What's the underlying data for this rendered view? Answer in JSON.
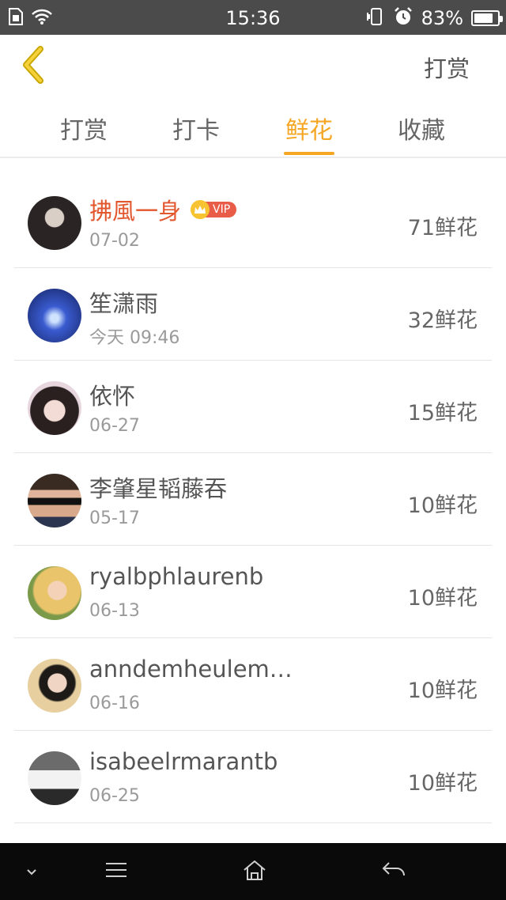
{
  "status_bar": {
    "time": "15:36",
    "battery": "83%",
    "battery_level": 0.83
  },
  "header": {
    "back_icon": "chevron-left-icon",
    "action_label": "打赏"
  },
  "tabs": [
    {
      "label": "打赏",
      "active": false
    },
    {
      "label": "打卡",
      "active": false
    },
    {
      "label": "鲜花",
      "active": true
    },
    {
      "label": "收藏",
      "active": false
    }
  ],
  "vip_label": "VIP",
  "list": [
    {
      "name": "拂風一身",
      "date": "07-02",
      "count": "71鲜花",
      "vip": true
    },
    {
      "name": "笙潇雨",
      "date": "今天 09:46",
      "count": "32鲜花",
      "vip": false
    },
    {
      "name": "依怀",
      "date": "06-27",
      "count": "15鲜花",
      "vip": false
    },
    {
      "name": "李肇星韬藤吞",
      "date": "05-17",
      "count": "10鲜花",
      "vip": false
    },
    {
      "name": "ryalbphlaurenb",
      "date": "06-13",
      "count": "10鲜花",
      "vip": false
    },
    {
      "name": "anndemheulem…",
      "date": "06-16",
      "count": "10鲜花",
      "vip": false
    },
    {
      "name": "isabeelrmarantb",
      "date": "06-25",
      "count": "10鲜花",
      "vip": false
    }
  ],
  "colors": {
    "accent": "#f5a623",
    "vip_name": "#e2572e",
    "status_bar": "#4b4b4b",
    "nav_bar": "#0a0a0a"
  },
  "navbar": {
    "icons": [
      "chevron-down-icon",
      "menu-icon",
      "home-icon",
      "back-arrow-icon"
    ]
  }
}
